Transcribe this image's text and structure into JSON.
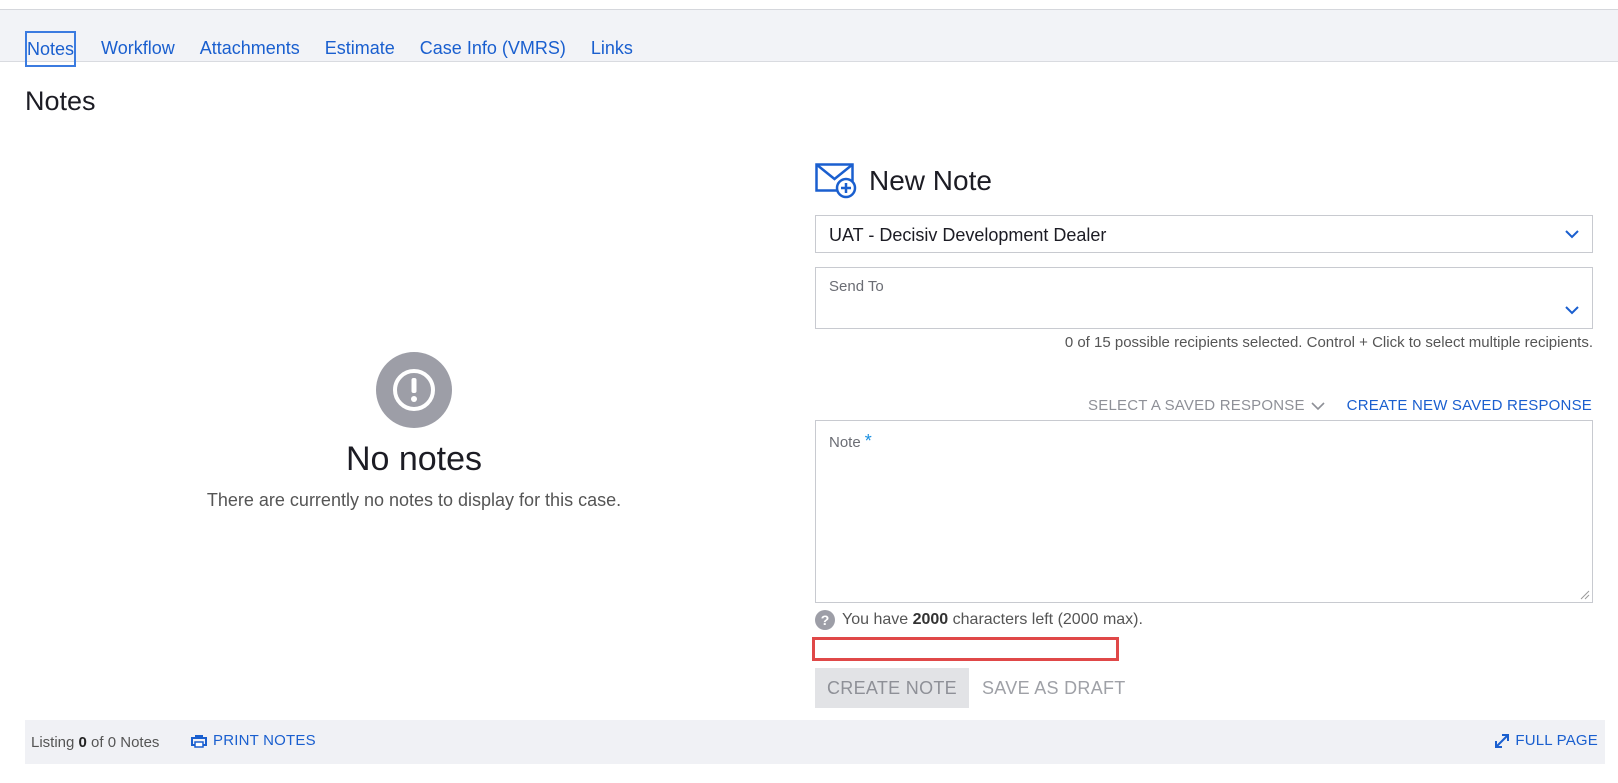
{
  "tabs": [
    {
      "label": "Notes",
      "active": true
    },
    {
      "label": "Workflow"
    },
    {
      "label": "Attachments"
    },
    {
      "label": "Estimate"
    },
    {
      "label": "Case Info (VMRS)"
    },
    {
      "label": "Links"
    }
  ],
  "page_title": "Notes",
  "empty_state": {
    "icon": "exclamation-circle-icon",
    "title": "No notes",
    "subtitle": "There are currently no notes to display for this case."
  },
  "new_note": {
    "icon": "envelope-plus-icon",
    "title": "New Note",
    "dealer_select_value": "UAT - Decisiv Development Dealer",
    "send_to_label": "Send To",
    "recipients_info": "0 of 15 possible recipients selected. Control + Click to select multiple recipients.",
    "saved_response_label": "SELECT A SAVED RESPONSE",
    "create_saved_response_label": "CREATE NEW SAVED RESPONSE",
    "note_label": "Note",
    "required_marker": "*",
    "chars_prefix": "You have",
    "chars_left": "2000",
    "chars_suffix": "characters left (2000 max).",
    "create_button": "CREATE NOTE",
    "draft_button": "SAVE AS DRAFT"
  },
  "footer": {
    "listing_prefix": "Listing",
    "listing_count": "0",
    "listing_suffix": "of 0 Notes",
    "print_label": "PRINT NOTES",
    "fullpage_label": "FULL PAGE"
  },
  "colors": {
    "accent": "#1a5fcf",
    "highlight_outline": "#e04848",
    "footer_bg": "#f0f1f5"
  }
}
